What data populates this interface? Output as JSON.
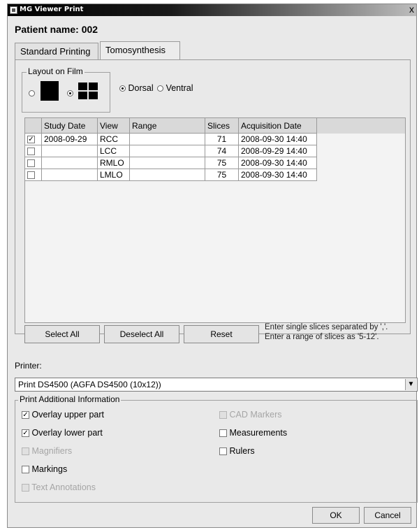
{
  "window": {
    "title": "MG Viewer Print",
    "close": "x"
  },
  "patient_label": "Patient name: 002",
  "tabs": [
    {
      "label": "Standard Printing",
      "active": false
    },
    {
      "label": "Tomosynthesis",
      "active": true
    }
  ],
  "layout": {
    "legend": "Layout on Film",
    "orientation": {
      "dorsal": "Dorsal",
      "ventral": "Ventral",
      "selected": "Dorsal"
    }
  },
  "table": {
    "headers": [
      "",
      "Study Date",
      "View",
      "Range",
      "Slices",
      "Acquisition Date"
    ],
    "rows": [
      {
        "checked": true,
        "study_date": "2008-09-29",
        "view": "RCC",
        "range": "",
        "slices": "71",
        "acq": "2008-09-30 14:40"
      },
      {
        "checked": false,
        "study_date": "",
        "view": "LCC",
        "range": "",
        "slices": "74",
        "acq": "2008-09-29 14:40"
      },
      {
        "checked": false,
        "study_date": "",
        "view": "RMLO",
        "range": "",
        "slices": "75",
        "acq": "2008-09-30 14:40"
      },
      {
        "checked": false,
        "study_date": "",
        "view": "LMLO",
        "range": "",
        "slices": "75",
        "acq": "2008-09-30 14:40"
      }
    ]
  },
  "buttons": {
    "select_all": "Select All",
    "deselect_all": "Deselect All",
    "reset": "Reset",
    "ok": "OK",
    "cancel": "Cancel"
  },
  "hint": {
    "line1": "Enter single slices separated by ','.",
    "line2": "Enter a range of slices as '5-12'."
  },
  "printer": {
    "label": "Printer:",
    "value": "Print DS4500 (AGFA DS4500 (10x12))"
  },
  "additional": {
    "legend": "Print Additional Information",
    "left": [
      {
        "label": "Overlay upper part",
        "checked": true,
        "enabled": true
      },
      {
        "label": "Overlay lower part",
        "checked": true,
        "enabled": true
      },
      {
        "label": "Magnifiers",
        "checked": false,
        "enabled": false
      },
      {
        "label": "Markings",
        "checked": false,
        "enabled": true
      },
      {
        "label": "Text Annotations",
        "checked": false,
        "enabled": false
      }
    ],
    "right": [
      {
        "label": "CAD Markers",
        "checked": false,
        "enabled": false
      },
      {
        "label": "Measurements",
        "checked": false,
        "enabled": true
      },
      {
        "label": "Rulers",
        "checked": false,
        "enabled": true
      }
    ]
  }
}
